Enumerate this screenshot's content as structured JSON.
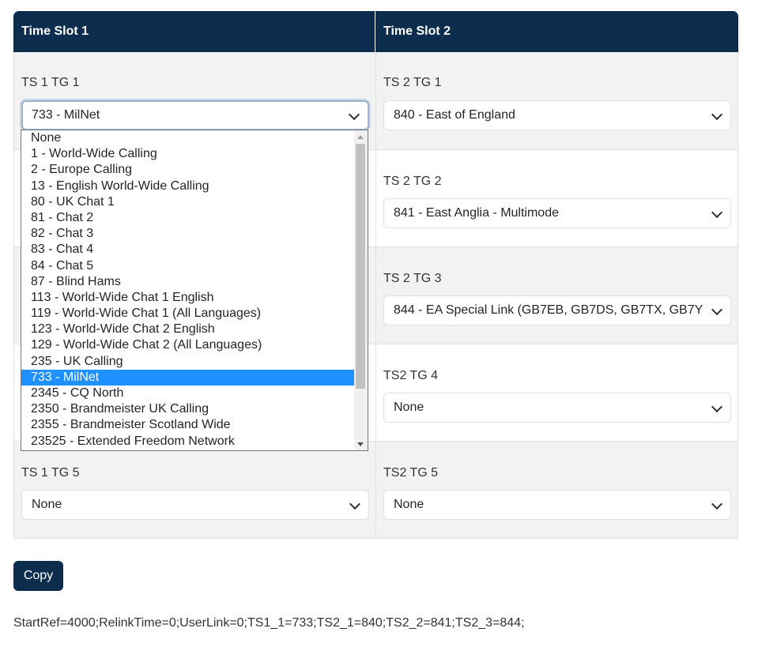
{
  "table": {
    "headers": [
      "Time Slot 1",
      "Time Slot 2"
    ],
    "rows": [
      {
        "ts1": {
          "label": "TS 1 TG 1",
          "value": "733 - MilNet"
        },
        "ts2": {
          "label": "TS 2 TG 1",
          "value": "840 - East of England"
        }
      },
      {
        "ts1": {
          "label": "",
          "value": ""
        },
        "ts2": {
          "label": "TS 2 TG 2",
          "value": "841 - East Anglia - Multimode"
        }
      },
      {
        "ts1": {
          "label": "",
          "value": ""
        },
        "ts2": {
          "label": "TS 2 TG 3",
          "value": "844 - EA Special Link (GB7EB, GB7DS, GB7TX, GB7Y"
        }
      },
      {
        "ts1": {
          "label": "",
          "value": ""
        },
        "ts2": {
          "label": "TS2 TG 4",
          "value": "None"
        }
      },
      {
        "ts1": {
          "label": "TS 1 TG 5",
          "value": "None"
        },
        "ts2": {
          "label": "TS2 TG 5",
          "value": "None"
        }
      }
    ]
  },
  "dropdown": {
    "selected": "733 - MilNet",
    "options": [
      "None",
      "1 - World-Wide Calling",
      "2 - Europe Calling",
      "13 - English World-Wide Calling",
      "80 - UK Chat 1",
      "81 - Chat 2",
      "82 - Chat 3",
      "83 - Chat 4",
      "84 - Chat 5",
      "87 - Blind Hams",
      "113 - World-Wide Chat 1 English",
      "119 - World-Wide Chat 1 (All Languages)",
      "123 - World-Wide Chat 2 English",
      "129 - World-Wide Chat 2 (All Languages)",
      "235 - UK Calling",
      "733 - MilNet",
      "2345 - CQ North",
      "2350 - Brandmeister UK Calling",
      "2355 - Brandmeister Scotland Wide",
      "23525 - Extended Freedom Network"
    ]
  },
  "copy_label": "Copy",
  "output_text": "StartRef=4000;RelinkTime=0;UserLink=0;TS1_1=733;TS2_1=840;TS2_2=841;TS2_3=844;",
  "colors": {
    "header_bg": "#0d2d4f",
    "selected_option": "#1e90ff",
    "row_grey": "#f2f2f2"
  },
  "icons": {
    "select_arrow": "chevron-down-icon"
  }
}
